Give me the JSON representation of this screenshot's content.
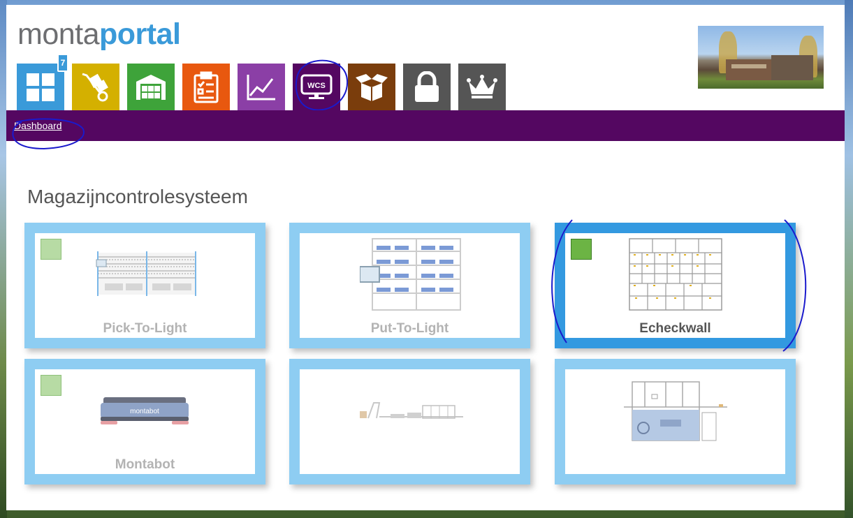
{
  "app": {
    "logo_light": "monta",
    "logo_bold": "portal"
  },
  "nav": {
    "badge_count": "7",
    "tiles": [
      {
        "icon": "dashboard-grid-icon",
        "color": "#3a9ad9"
      },
      {
        "icon": "hand-truck-icon",
        "color": "#d4b000"
      },
      {
        "icon": "warehouse-icon",
        "color": "#3ea33a"
      },
      {
        "icon": "clipboard-checklist-icon",
        "color": "#e8580f"
      },
      {
        "icon": "line-chart-icon",
        "color": "#8b3fa6"
      },
      {
        "icon": "wcs-monitor-icon",
        "color": "#540761",
        "label": "WCS"
      },
      {
        "icon": "open-box-icon",
        "color": "#7a3d0c"
      },
      {
        "icon": "lock-icon",
        "color": "#555555"
      },
      {
        "icon": "crown-icon",
        "color": "#555555"
      }
    ]
  },
  "breadcrumb": {
    "label": "Dashboard"
  },
  "main": {
    "title": "Magazijncontrolesysteem",
    "cards": [
      {
        "label": "Pick-To-Light",
        "status": "inactive"
      },
      {
        "label": "Put-To-Light",
        "status": "none"
      },
      {
        "label": "Echeckwall",
        "status": "active"
      },
      {
        "label": "Montabot",
        "status": "inactive",
        "robot_text": "montabot"
      },
      {
        "label": "",
        "status": "none"
      },
      {
        "label": "",
        "status": "none"
      }
    ]
  },
  "colors": {
    "accent": "#3a9ad9",
    "breadcrumb_bar": "#540761",
    "card_border": "#8ecdf2",
    "card_border_active": "#3399e0"
  }
}
